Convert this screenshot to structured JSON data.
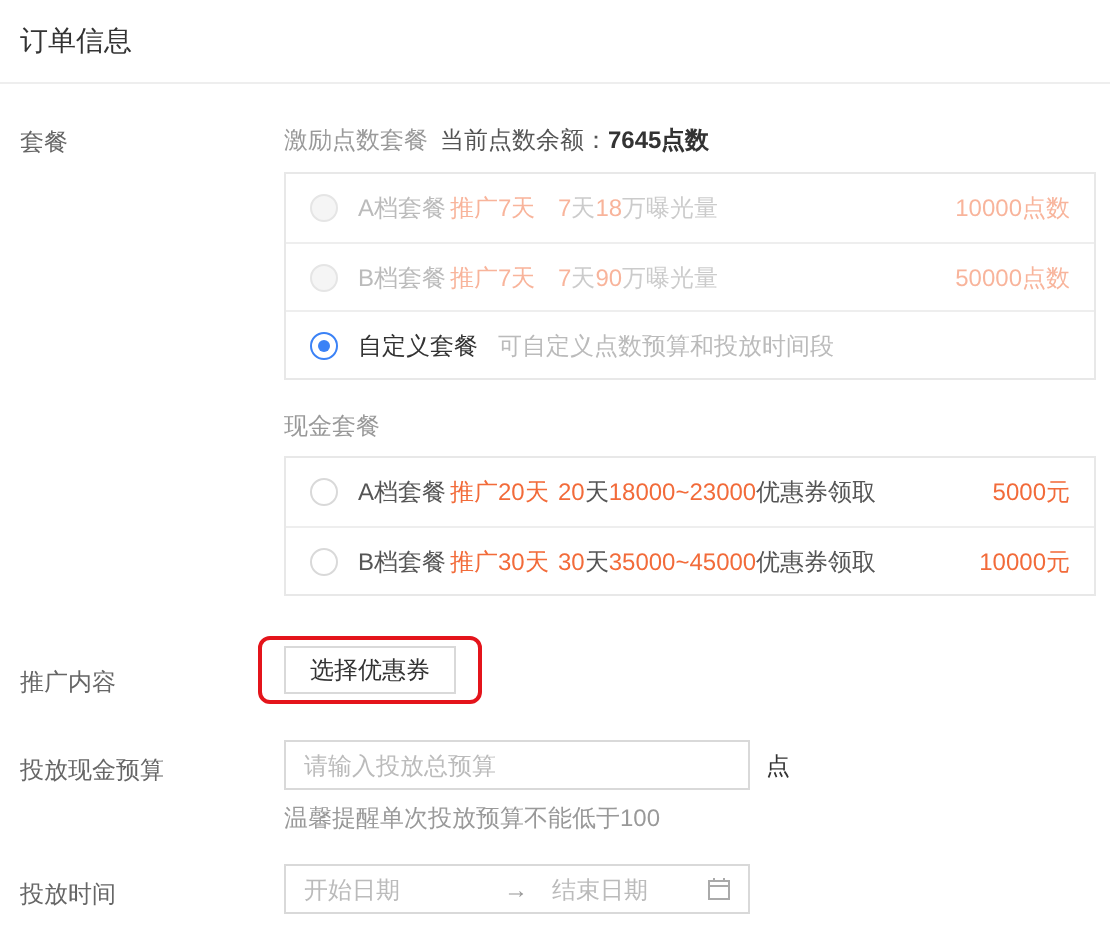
{
  "title": "订单信息",
  "package": {
    "label": "套餐",
    "points_group": {
      "title": "激励点数套餐",
      "balance_label": "当前点数余额：",
      "balance": "7645点数",
      "options": [
        {
          "kind": "plan",
          "name": "A档套餐",
          "promo": "推广7天",
          "detail": [
            {
              "text": "7",
              "accent": true
            },
            {
              "text": "天",
              "accent": false
            },
            {
              "text": "18",
              "accent": true
            },
            {
              "text": "万曝光量",
              "accent": false
            }
          ],
          "price": "10000点数",
          "selected": false,
          "disabled": true
        },
        {
          "kind": "plan",
          "name": "B档套餐",
          "promo": "推广7天",
          "detail": [
            {
              "text": "7",
              "accent": true
            },
            {
              "text": "天",
              "accent": false
            },
            {
              "text": "90",
              "accent": true
            },
            {
              "text": "万曝光量",
              "accent": false
            }
          ],
          "price": "50000点数",
          "selected": false,
          "disabled": true
        },
        {
          "kind": "custom",
          "name": "自定义套餐",
          "description": "可自定义点数预算和投放时间段",
          "selected": true
        }
      ]
    },
    "cash_group": {
      "title": "现金套餐",
      "options": [
        {
          "kind": "plan",
          "name": "A档套餐",
          "promo": "推广20天",
          "detail": [
            {
              "text": "20",
              "accent": true
            },
            {
              "text": "天",
              "accent": false
            },
            {
              "text": "18000~23000",
              "accent": true
            },
            {
              "text": "优惠券领取",
              "accent": false
            }
          ],
          "price": "5000元",
          "selected": false,
          "disabled": false
        },
        {
          "kind": "plan",
          "name": "B档套餐",
          "promo": "推广30天",
          "detail": [
            {
              "text": "30",
              "accent": true
            },
            {
              "text": "天",
              "accent": false
            },
            {
              "text": "35000~45000",
              "accent": true
            },
            {
              "text": "优惠券领取",
              "accent": false
            }
          ],
          "price": "10000元",
          "selected": false,
          "disabled": false
        }
      ]
    }
  },
  "content": {
    "label": "推广内容",
    "button": "选择优惠券",
    "highlighted": true
  },
  "budget": {
    "label": "投放现金预算",
    "placeholder": "请输入投放总预算",
    "unit": "点",
    "hint": "温馨提醒单次投放预算不能低于100"
  },
  "time": {
    "label": "投放时间",
    "start_placeholder": "开始日期",
    "separator": "→",
    "end_placeholder": "结束日期"
  }
}
